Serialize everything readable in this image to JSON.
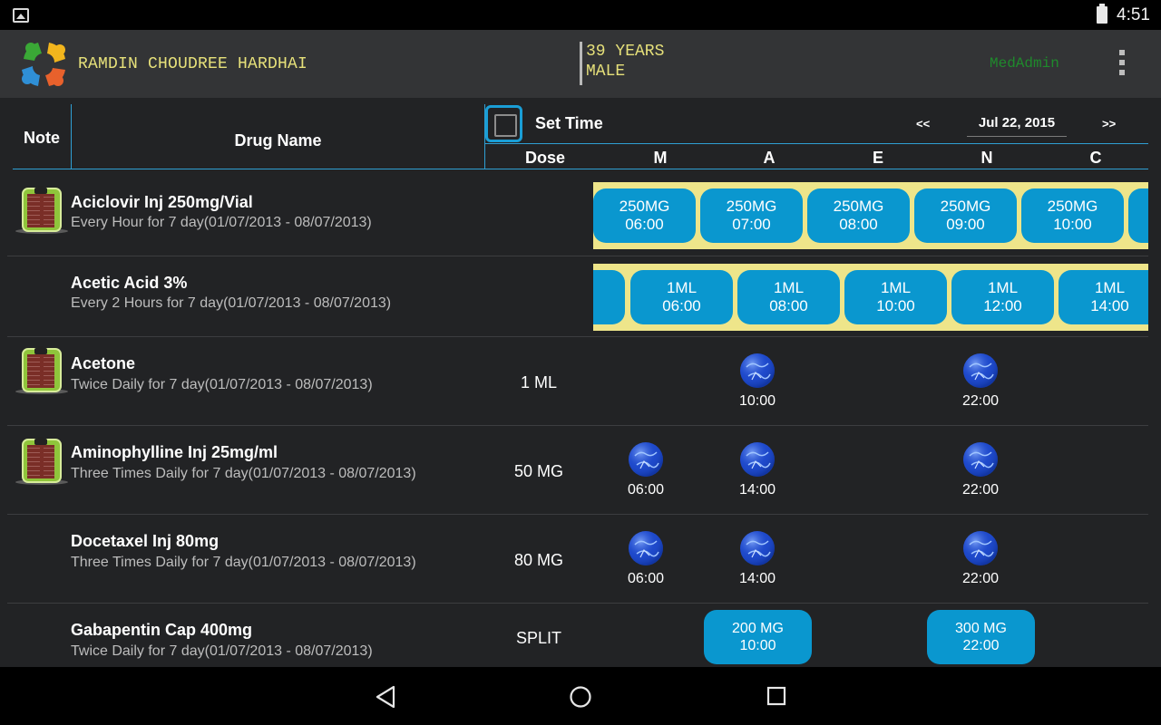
{
  "status_bar": {
    "time": "4:51"
  },
  "header": {
    "patient_name": "RAMDIN CHOUDREE HARDHAI",
    "age": "39 YEARS",
    "sex": "MALE",
    "user": "MedAdmin"
  },
  "grid": {
    "note_label": "Note",
    "drug_label": "Drug Name",
    "set_time_label": "Set Time",
    "prev_label": "<<",
    "next_label": ">>",
    "date": "Jul 22, 2015",
    "dose_label": "Dose",
    "col_m": "M",
    "col_a": "A",
    "col_e": "E",
    "col_n": "N",
    "col_c": "C"
  },
  "rows": [
    {
      "name": "Aciclovir Inj 250mg/Vial",
      "freq": "Every Hour for 7 day(01/07/2013 - 08/07/2013)",
      "slots": [
        {
          "dose": "250MG",
          "time": "06:00"
        },
        {
          "dose": "250MG",
          "time": "07:00"
        },
        {
          "dose": "250MG",
          "time": "08:00"
        },
        {
          "dose": "250MG",
          "time": "09:00"
        },
        {
          "dose": "250MG",
          "time": "10:00"
        }
      ]
    },
    {
      "name": "Acetic Acid 3%",
      "freq": "Every 2 Hours for 7 day(01/07/2013 - 08/07/2013)",
      "slots": [
        {
          "dose": "1ML",
          "time": "06:00"
        },
        {
          "dose": "1ML",
          "time": "08:00"
        },
        {
          "dose": "1ML",
          "time": "10:00"
        },
        {
          "dose": "1ML",
          "time": "12:00"
        },
        {
          "dose": "1ML",
          "time": "14:00"
        }
      ]
    },
    {
      "name": "Acetone",
      "freq": "Twice Daily for 7 day(01/07/2013 - 08/07/2013)",
      "dose": "1 ML",
      "times": [
        "10:00",
        "22:00"
      ]
    },
    {
      "name": "Aminophylline Inj 25mg/ml",
      "freq": "Three Times Daily for 7 day(01/07/2013 - 08/07/2013)",
      "dose": "50 MG",
      "times": [
        "06:00",
        "14:00",
        "22:00"
      ]
    },
    {
      "name": "Docetaxel Inj 80mg",
      "freq": "Three Times Daily for 7 day(01/07/2013 - 08/07/2013)",
      "dose": "80 MG",
      "times": [
        "06:00",
        "14:00",
        "22:00"
      ]
    },
    {
      "name": "Gabapentin Cap 400mg",
      "freq": "Twice Daily for 7 day(01/07/2013 - 08/07/2013)",
      "dose": "SPLIT",
      "slots": [
        {
          "dose": "200 MG",
          "time": "10:00"
        },
        {
          "dose": "300 MG",
          "time": "22:00"
        }
      ]
    }
  ]
}
